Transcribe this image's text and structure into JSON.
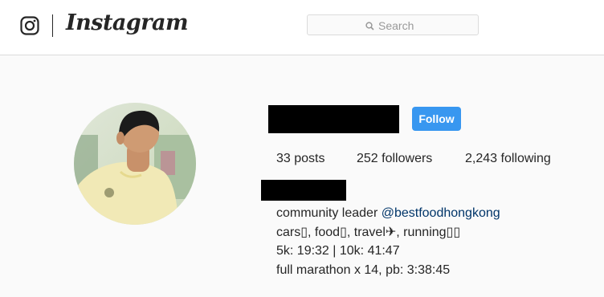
{
  "header": {
    "logo_text": "Instagram",
    "search_placeholder": "Search",
    "search_icon": "search-icon",
    "camera_icon": "instagram-camera-icon"
  },
  "profile": {
    "follow_label": "Follow",
    "stats": [
      {
        "value": "33",
        "label": "posts"
      },
      {
        "value": "252",
        "label": "followers"
      },
      {
        "value": "2,243",
        "label": "following"
      }
    ],
    "bio": {
      "line1_prefix": "community leader ",
      "line1_mention": "@bestfoodhongkong",
      "line2": "cars▯, food▯, travel✈, running▯▯",
      "line3": "5k: 19:32 | 10k: 41:47",
      "line4": "full marathon x 14, pb: 3:38:45"
    }
  },
  "colors": {
    "follow_button": "#3897f0",
    "mention": "#003569",
    "redaction": "#000000"
  }
}
